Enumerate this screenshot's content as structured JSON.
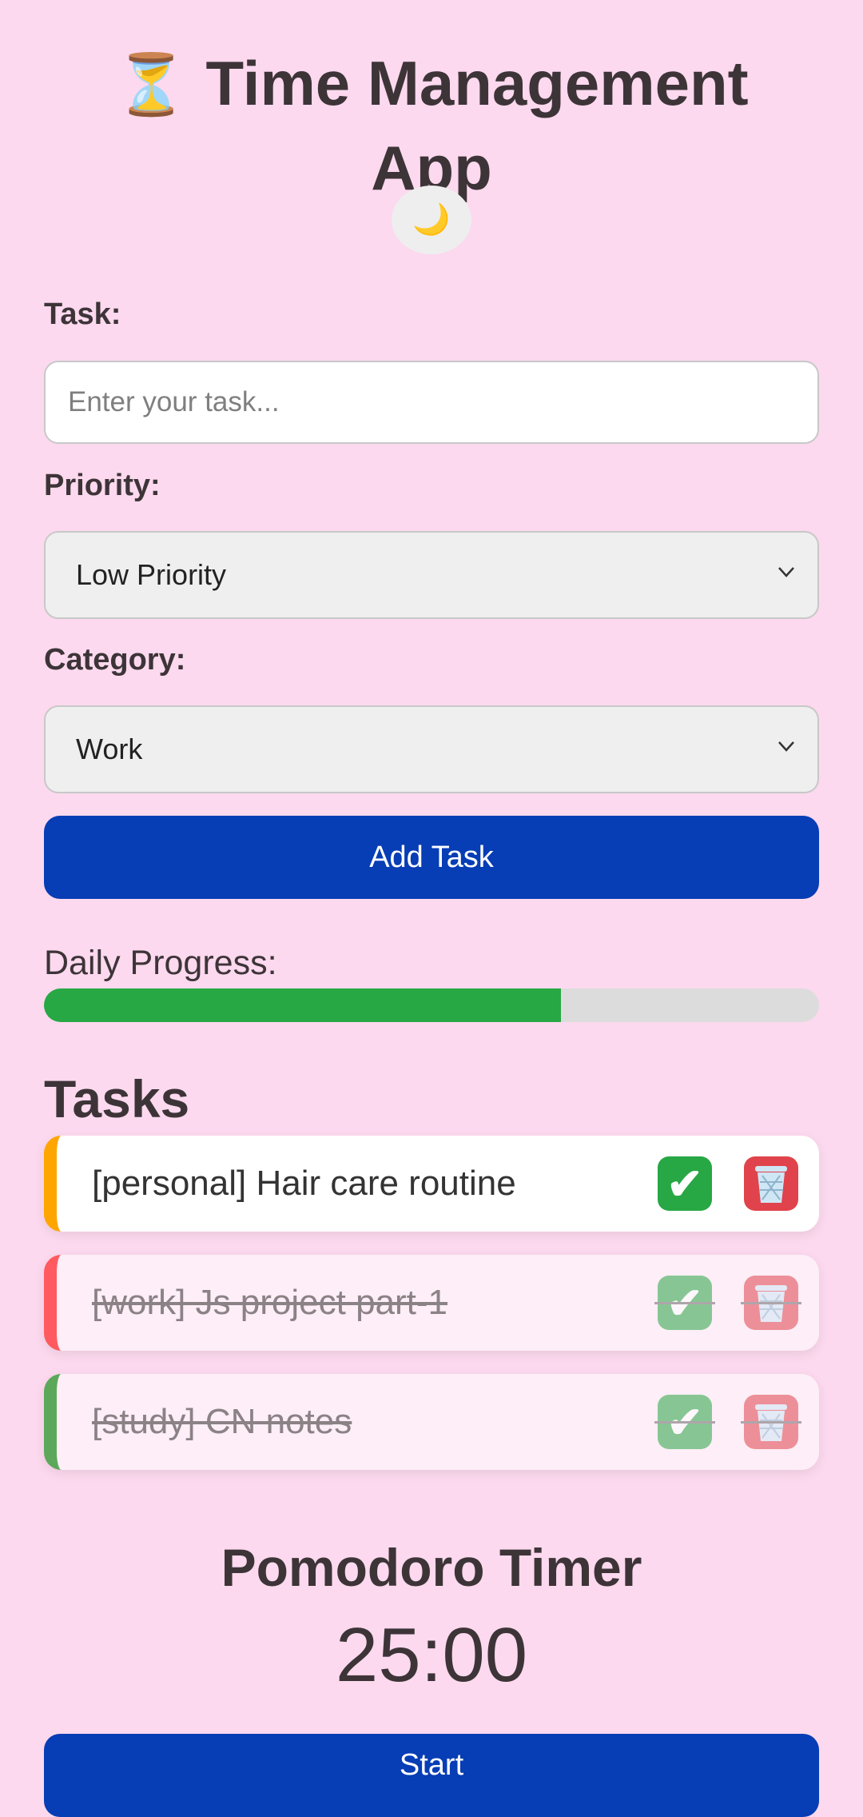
{
  "header": {
    "title_line1": "Time Management",
    "title_line2": "App",
    "title_icon": "hourglass-icon",
    "theme_toggle_icon": "moon-icon"
  },
  "form": {
    "task_label": "Task:",
    "task_placeholder": "Enter your task...",
    "task_value": "",
    "priority_label": "Priority:",
    "priority_selected": "Low Priority",
    "category_label": "Category:",
    "category_selected": "Work",
    "add_button_label": "Add Task"
  },
  "progress": {
    "label": "Daily Progress:",
    "fraction": 0.667
  },
  "tasks": {
    "heading": "Tasks",
    "items": [
      {
        "text": "[personal] Hair care routine",
        "completed": false,
        "accent": "#ffa500"
      },
      {
        "text": "[work] Js project part-1",
        "completed": true,
        "accent": "#ff5a5f"
      },
      {
        "text": "[study] CN notes",
        "completed": true,
        "accent": "#5ba85b"
      }
    ]
  },
  "pomodoro": {
    "title": "Pomodoro Timer",
    "time": "25:00",
    "start_label": "Start"
  },
  "colors": {
    "background": "#fcd9ee",
    "primary": "#073db5",
    "success": "#28a745",
    "danger": "#e0434b"
  }
}
